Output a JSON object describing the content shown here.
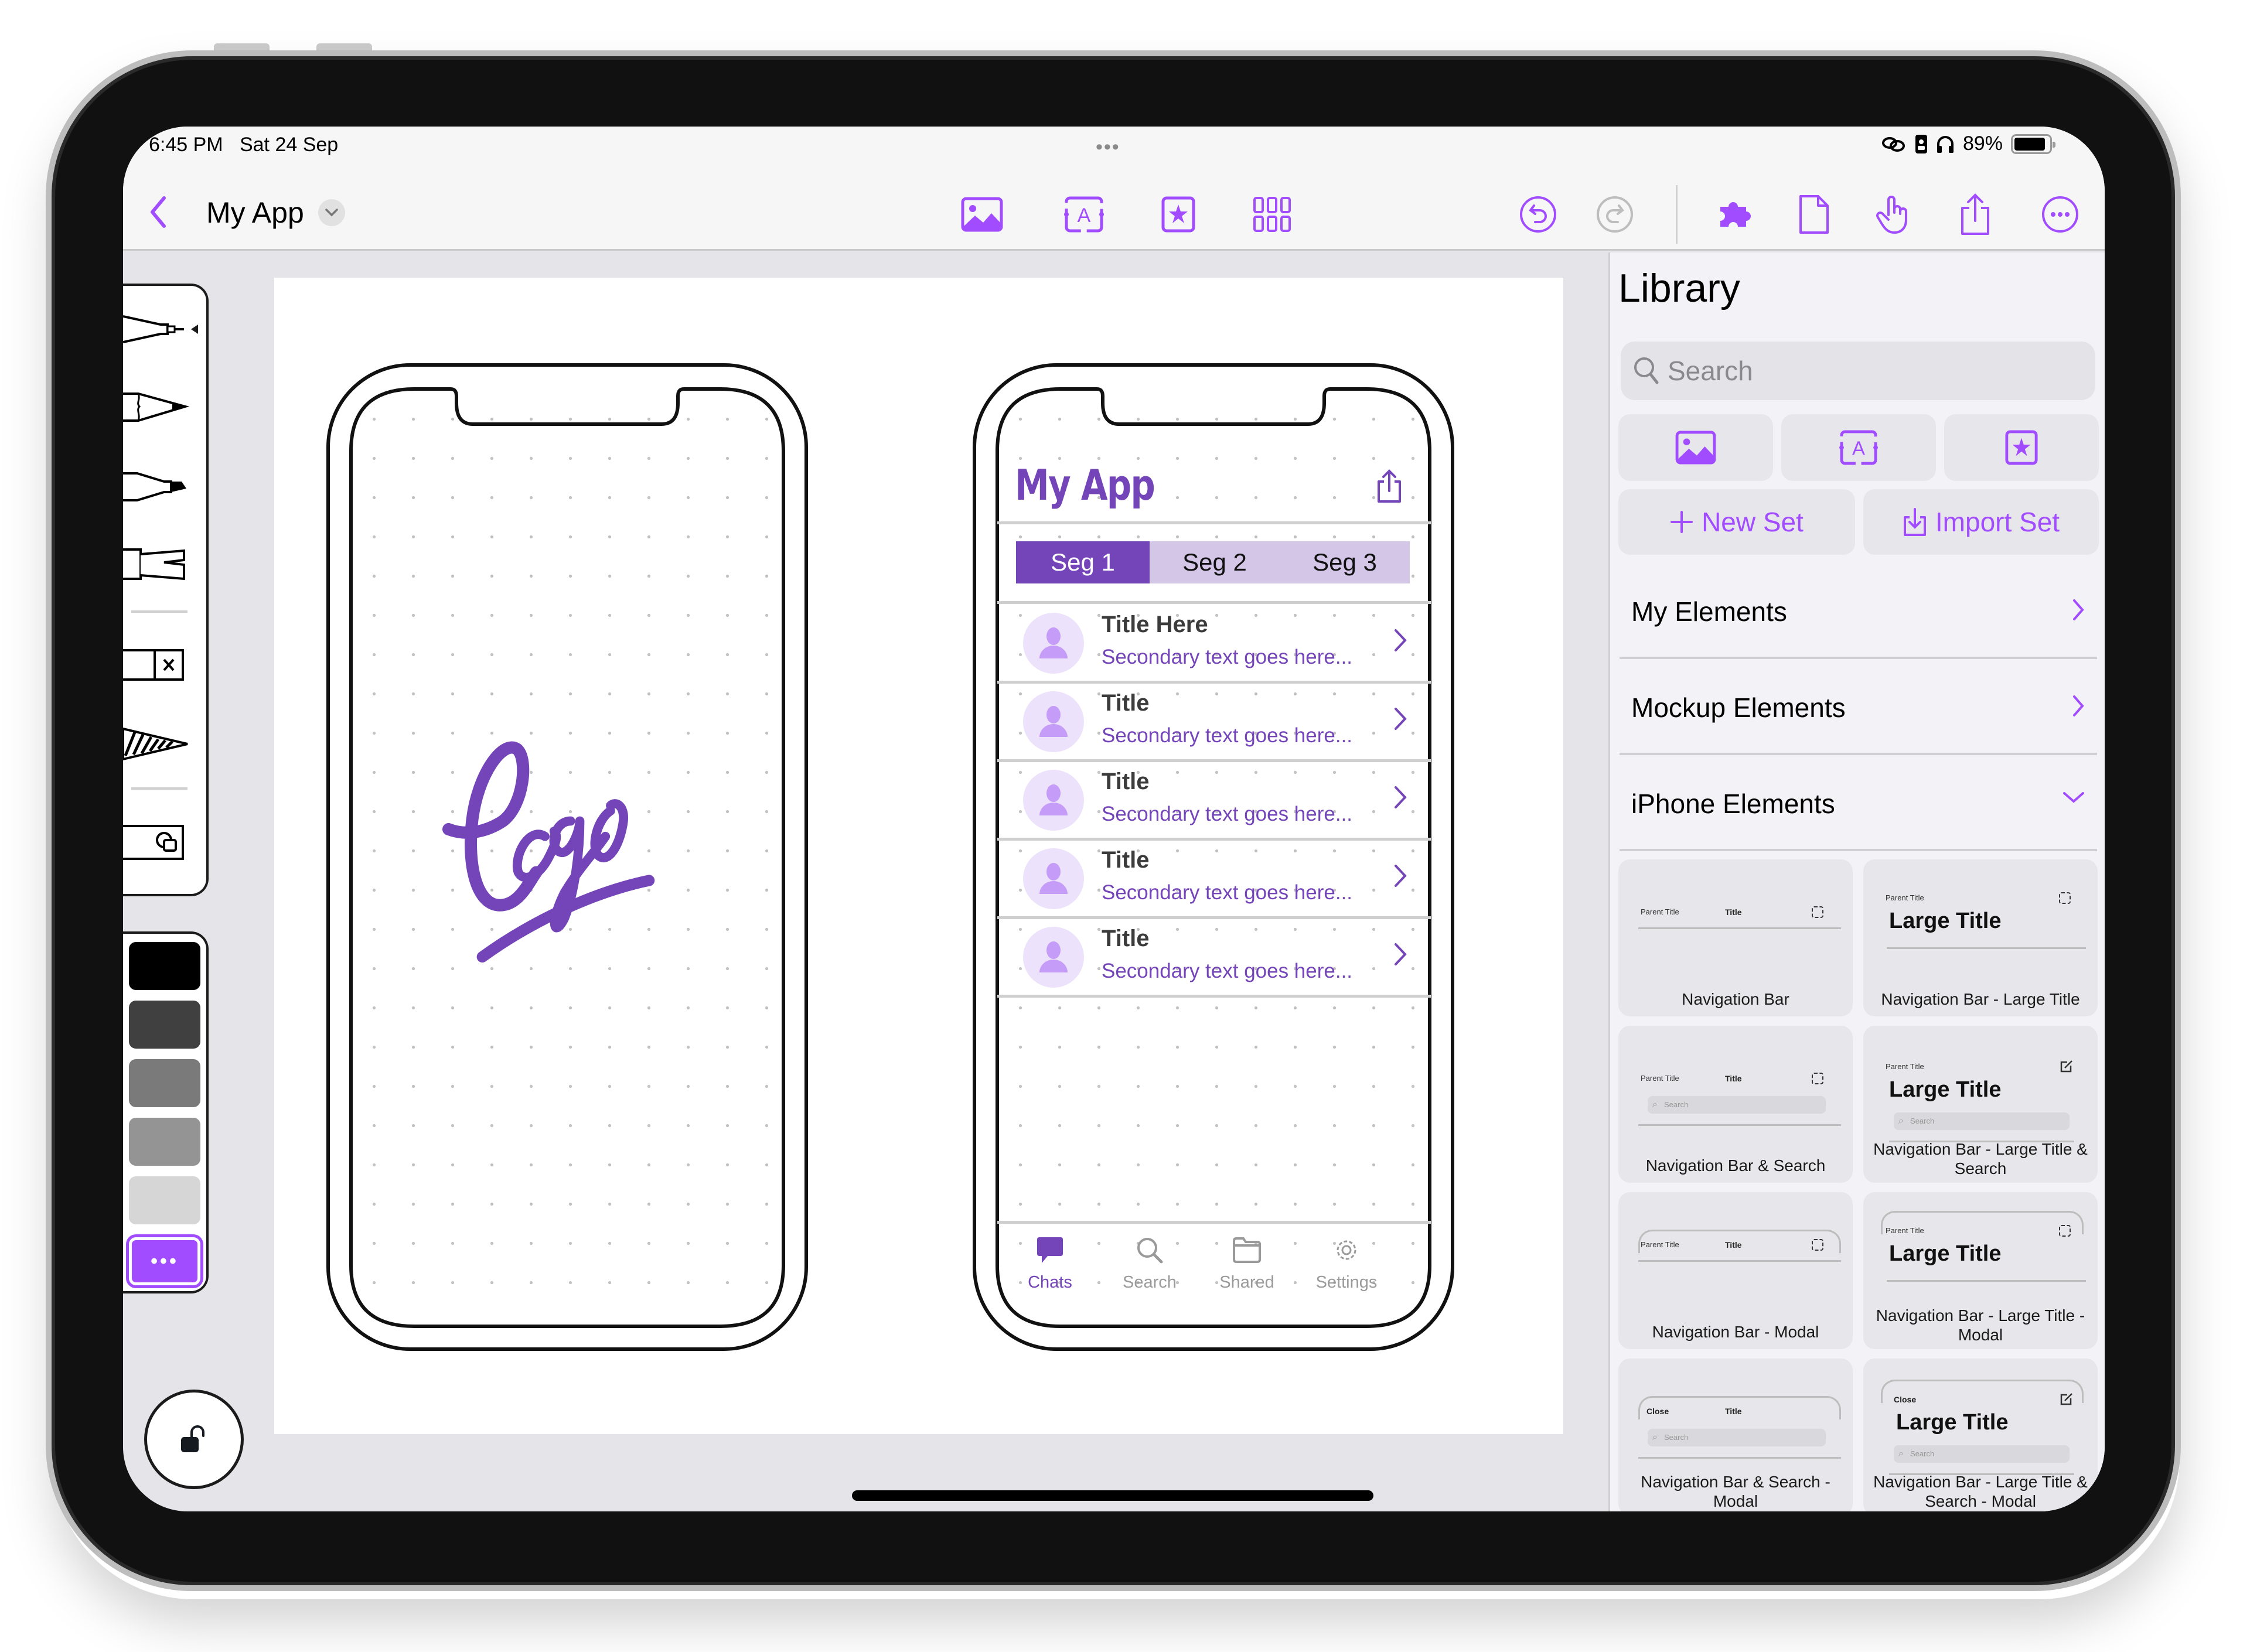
{
  "status_bar": {
    "time": "6:45 PM",
    "date": "Sat 24 Sep",
    "multitask_dots": "•••",
    "battery_percent": "89%",
    "battery_level": 0.89,
    "icons": [
      "link-icon",
      "orientation-lock-icon",
      "headphones-icon",
      "battery-icon"
    ]
  },
  "toolbar": {
    "back_icon": "chevron-left-icon",
    "document_title": "My App",
    "title_menu_icon": "chevron-down-icon",
    "center_tools": [
      {
        "name": "insert-image",
        "icon": "photo-icon"
      },
      {
        "name": "insert-text",
        "icon": "text-box-icon"
      },
      {
        "name": "insert-symbol",
        "icon": "star-box-icon"
      },
      {
        "name": "grid",
        "icon": "grid-icon"
      }
    ],
    "right_tools": [
      {
        "name": "undo",
        "icon": "undo-icon",
        "enabled": true
      },
      {
        "name": "redo",
        "icon": "redo-icon",
        "enabled": false
      },
      {
        "name": "library",
        "icon": "puzzle-icon",
        "active": true
      },
      {
        "name": "page",
        "icon": "document-icon"
      },
      {
        "name": "touch",
        "icon": "hand-pointer-icon"
      },
      {
        "name": "share",
        "icon": "share-icon"
      },
      {
        "name": "more",
        "icon": "ellipsis-circle-icon"
      }
    ]
  },
  "tool_palette": {
    "tools": [
      {
        "name": "fine-pen",
        "icon": "fine-pen-icon",
        "selected": true
      },
      {
        "name": "pencil",
        "icon": "pencil-icon"
      },
      {
        "name": "marker",
        "icon": "marker-icon"
      },
      {
        "name": "brush",
        "icon": "brush-icon"
      },
      {
        "name": "eraser",
        "icon": "eraser-icon"
      },
      {
        "name": "fill",
        "icon": "hatch-fill-icon"
      },
      {
        "name": "lasso",
        "icon": "lasso-icon"
      }
    ],
    "colors": [
      {
        "name": "black",
        "hex": "#000000"
      },
      {
        "name": "dark-gray",
        "hex": "#404040"
      },
      {
        "name": "gray",
        "hex": "#7a7a7a"
      },
      {
        "name": "mid-gray",
        "hex": "#949494"
      },
      {
        "name": "light-gray",
        "hex": "#d6d6d6"
      }
    ],
    "more_colors_label": "•••",
    "more_colors_hex": "#a14cff",
    "lock_icon": "unlock-icon"
  },
  "canvas": {
    "left_phone": {
      "logo_text": "Logo",
      "logo_color": "#7444b9"
    },
    "right_phone": {
      "app_title": "My App",
      "share_icon": "share-icon",
      "segments": [
        "Seg 1",
        "Seg 2",
        "Seg 3"
      ],
      "selected_segment": 0,
      "list": [
        {
          "title": "Title Here",
          "subtitle": "Secondary text goes here..."
        },
        {
          "title": "Title",
          "subtitle": "Secondary text goes here..."
        },
        {
          "title": "Title",
          "subtitle": "Secondary text goes here..."
        },
        {
          "title": "Title",
          "subtitle": "Secondary text goes here..."
        },
        {
          "title": "Title",
          "subtitle": "Secondary text goes here..."
        }
      ],
      "tabs": [
        {
          "label": "Chats",
          "icon": "chat-bubble-icon",
          "active": true
        },
        {
          "label": "Search",
          "icon": "search-icon"
        },
        {
          "label": "Shared",
          "icon": "folder-icon"
        },
        {
          "label": "Settings",
          "icon": "gear-icon"
        }
      ],
      "accent": "#7444b9",
      "segment_bg": "#d4c6e6"
    }
  },
  "library": {
    "title": "Library",
    "search_placeholder": "Search",
    "type_buttons": [
      {
        "name": "images",
        "icon": "photo-icon"
      },
      {
        "name": "text",
        "icon": "text-box-icon"
      },
      {
        "name": "symbols",
        "icon": "star-box-icon"
      }
    ],
    "new_set_label": "New Set",
    "import_set_label": "Import Set",
    "sections": [
      {
        "label": "My Elements",
        "expanded": false
      },
      {
        "label": "Mockup Elements",
        "expanded": false
      },
      {
        "label": "iPhone Elements",
        "expanded": true
      }
    ],
    "cards": [
      {
        "caption": "Navigation Bar",
        "parent": "Parent Title",
        "title": "Title"
      },
      {
        "caption": "Navigation Bar - Large Title",
        "parent": "Parent Title",
        "title": "Large Title"
      },
      {
        "caption": "Navigation Bar & Search",
        "parent": "Parent Title",
        "title": "Title",
        "search": "Search"
      },
      {
        "caption": "Navigation Bar - Large Title & Search",
        "parent": "Parent Title",
        "title": "Large Title",
        "search": "Search"
      },
      {
        "caption": "Navigation Bar - Modal",
        "parent": "Parent Title",
        "title": "Title"
      },
      {
        "caption": "Navigation Bar - Large Title - Modal",
        "parent": "Parent Title",
        "title": "Large Title"
      },
      {
        "caption": "Navigation Bar & Search - Modal",
        "parent": "Close",
        "title": "Title",
        "search": "Search"
      },
      {
        "caption": "Navigation Bar - Large Title & Search - Modal",
        "parent": "Close",
        "title": "Large Title",
        "search": "Search"
      }
    ],
    "accent": "#a14cff"
  }
}
